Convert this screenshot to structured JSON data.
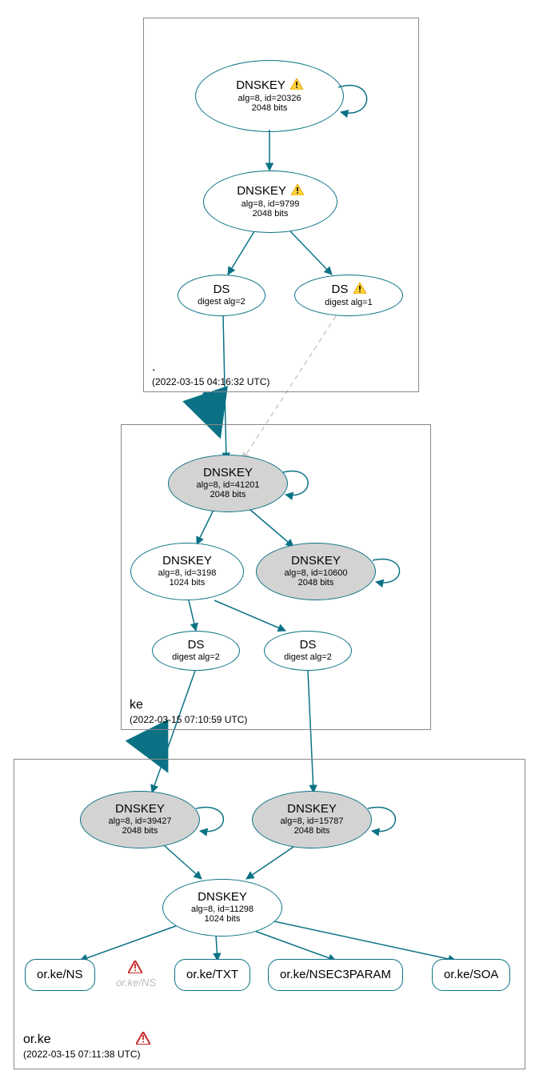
{
  "colors": {
    "teal": "#0b7285",
    "gray_fill": "#d3d3d3",
    "ghost": "#bbbbbb"
  },
  "warn_glyph": "⚠",
  "err_glyph": "⚠",
  "zones": {
    "root": {
      "label": ".",
      "ts": "(2022-03-15 04:16:32 UTC)"
    },
    "ke": {
      "label": "ke",
      "ts": "(2022-03-15 07:10:59 UTC)"
    },
    "orke": {
      "label": "or.ke",
      "ts": "(2022-03-15 07:11:38 UTC)"
    }
  },
  "nodes": {
    "root_ksk": {
      "title": "DNSKEY",
      "l1": "alg=8, id=20326",
      "l2": "2048 bits",
      "warn": true
    },
    "root_zsk": {
      "title": "DNSKEY",
      "l1": "alg=8, id=9799",
      "l2": "2048 bits",
      "warn": true
    },
    "root_ds2": {
      "title": "DS",
      "l1": "digest alg=2"
    },
    "root_ds1": {
      "title": "DS",
      "l1": "digest alg=1",
      "warn": true
    },
    "ke_ksk": {
      "title": "DNSKEY",
      "l1": "alg=8, id=41201",
      "l2": "2048 bits"
    },
    "ke_zsk": {
      "title": "DNSKEY",
      "l1": "alg=8, id=3198",
      "l2": "1024 bits"
    },
    "ke_extra": {
      "title": "DNSKEY",
      "l1": "alg=8, id=10600",
      "l2": "2048 bits"
    },
    "ke_ds_a": {
      "title": "DS",
      "l1": "digest alg=2"
    },
    "ke_ds_b": {
      "title": "DS",
      "l1": "digest alg=2"
    },
    "orke_ksk_a": {
      "title": "DNSKEY",
      "l1": "alg=8, id=39427",
      "l2": "2048 bits"
    },
    "orke_ksk_b": {
      "title": "DNSKEY",
      "l1": "alg=8, id=15787",
      "l2": "2048 bits"
    },
    "orke_zsk": {
      "title": "DNSKEY",
      "l1": "alg=8, id=11298",
      "l2": "1024 bits"
    },
    "rr_ns": {
      "label": "or.ke/NS"
    },
    "rr_ns_ghost": {
      "label": "or.ke/NS"
    },
    "rr_txt": {
      "label": "or.ke/TXT"
    },
    "rr_n3p": {
      "label": "or.ke/NSEC3PARAM"
    },
    "rr_soa": {
      "label": "or.ke/SOA"
    }
  }
}
